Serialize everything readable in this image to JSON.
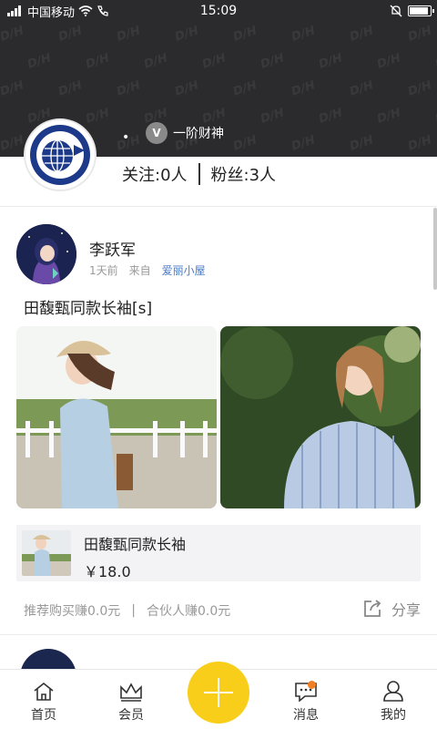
{
  "status_bar": {
    "carrier": "中国移动",
    "time": "15:09"
  },
  "profile": {
    "level_label": "一阶财神",
    "level_icon_text": "V",
    "follow_text": "关注:0人",
    "fans_text": "粉丝:3人"
  },
  "post": {
    "author": "李跃军",
    "time_ago": "1天前",
    "from_label": "来自",
    "from_source": "爱丽小屋",
    "title": "田馥甄同款长袖[s]",
    "product": {
      "name": "田馥甄同款长袖",
      "price": "￥18.0"
    },
    "recommend_earn": "推荐购买赚0.0元",
    "separator": "|",
    "partner_earn": "合伙人赚0.0元",
    "share_label": "分享"
  },
  "nav": {
    "home": "首页",
    "member": "会员",
    "messages": "消息",
    "mine": "我的"
  },
  "colors": {
    "header_bg": "#2b2a2c",
    "accent_yellow": "#f8ce1a",
    "link_blue": "#4a7ac8",
    "notify_orange": "#f17f22"
  }
}
